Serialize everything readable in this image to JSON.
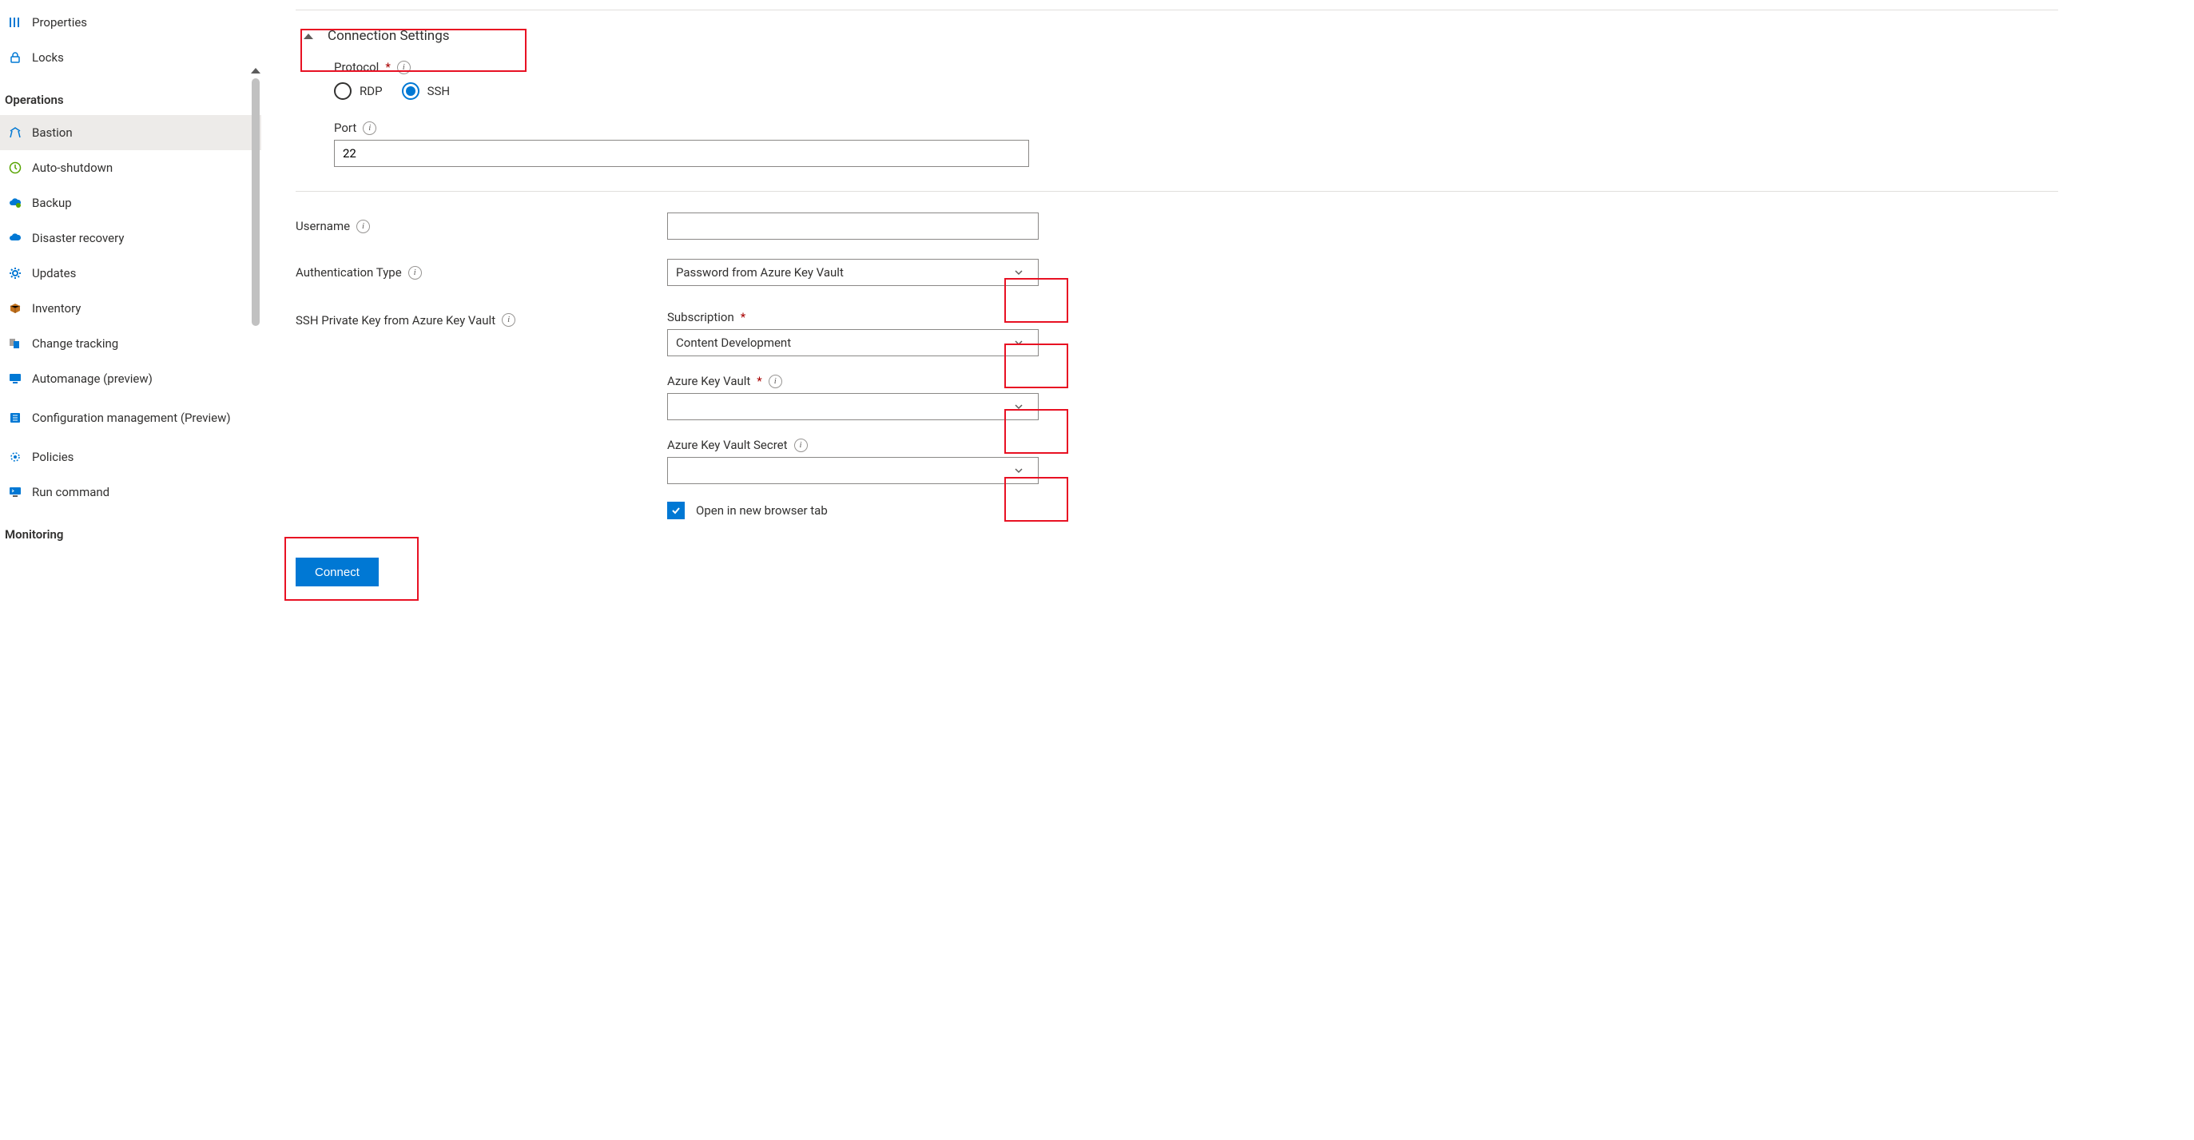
{
  "sidebar": {
    "groups": [
      "Operations",
      "Monitoring"
    ],
    "items": {
      "properties": "Properties",
      "locks": "Locks",
      "bastion": "Bastion",
      "autoshutdown": "Auto-shutdown",
      "backup": "Backup",
      "dr": "Disaster recovery",
      "updates": "Updates",
      "inventory": "Inventory",
      "changetrack": "Change tracking",
      "automanage": "Automanage (preview)",
      "configmgmt": "Configuration management (Preview)",
      "policies": "Policies",
      "runcmd": "Run command"
    }
  },
  "form": {
    "collapsible_title": "Connection Settings",
    "protocol_label": "Protocol",
    "protocol_options": {
      "rdp": "RDP",
      "ssh": "SSH"
    },
    "protocol_value": "ssh",
    "port_label": "Port",
    "port_value": "22",
    "username_label": "Username",
    "username_value": "",
    "authtype_label": "Authentication Type",
    "authtype_value": "Password from Azure Key Vault",
    "sshkey_label": "SSH Private Key from Azure Key Vault",
    "subscription_label": "Subscription",
    "subscription_value": "Content Development",
    "vault_label": "Azure Key Vault",
    "vault_value": "",
    "secret_label": "Azure Key Vault Secret",
    "secret_value": "",
    "newtab_label": "Open in new browser tab",
    "newtab_checked": true,
    "connect_label": "Connect"
  }
}
